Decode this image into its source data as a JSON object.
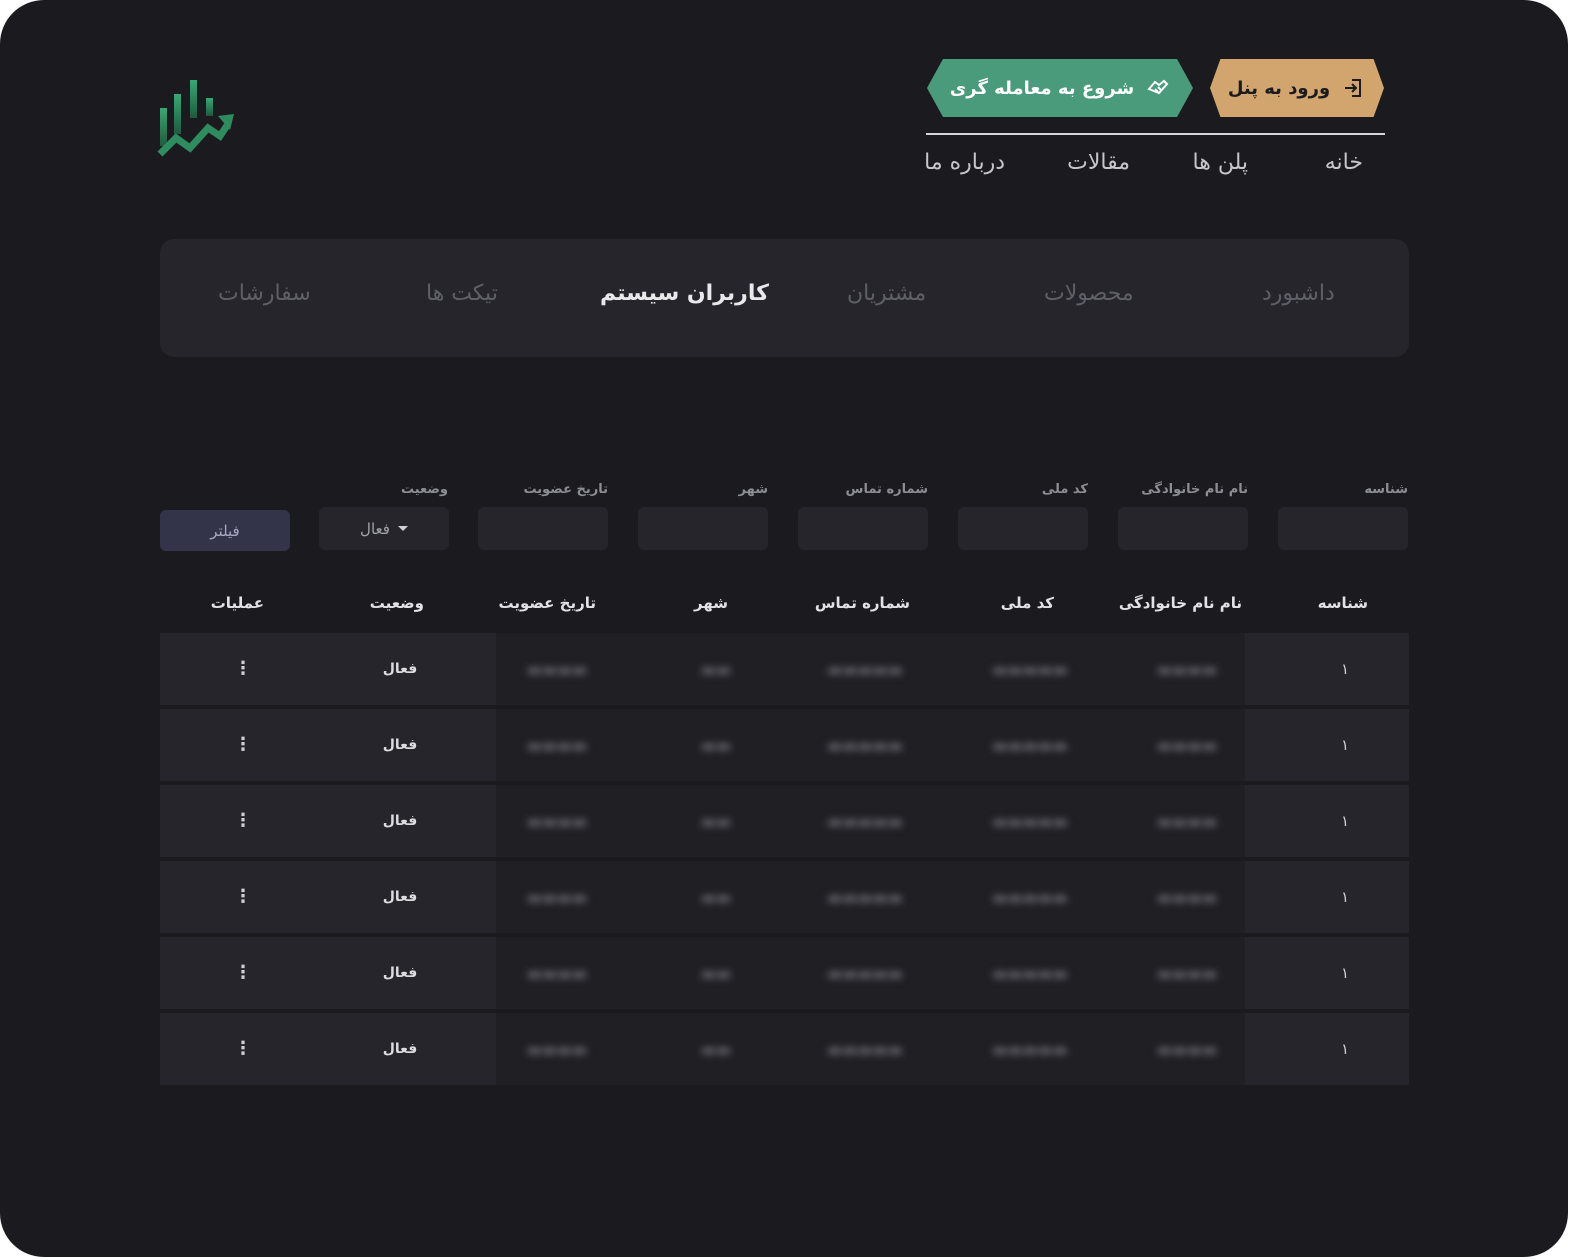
{
  "header": {
    "login_button": "ورود به پنل",
    "trade_button": "شروع به معامله گری",
    "nav": [
      "خانه",
      "پلن ها",
      "مقالات",
      "درباره ما"
    ]
  },
  "tabs": [
    "داشبورد",
    "محصولات",
    "مشتریان",
    "کاربران سیستم",
    "تیکت ها",
    "سفارشات"
  ],
  "active_tab": "کاربران سیستم",
  "filters": {
    "labels": [
      "شناسه",
      "نام نام خانوادگی",
      "کد ملی",
      "شماره تماس",
      "شهر",
      "تاریخ عضویت",
      "وضعیت"
    ],
    "status_value": "فعال",
    "filter_button": "فیلتر"
  },
  "table": {
    "headers": [
      "شناسه",
      "نام نام خانوادگی",
      "کد ملی",
      "شماره تماس",
      "شهر",
      "تاریخ عضویت",
      "وضعیت",
      "عملیات"
    ],
    "rows": [
      {
        "id": "۱",
        "status": "فعال"
      },
      {
        "id": "۱",
        "status": "فعال"
      },
      {
        "id": "۱",
        "status": "فعال"
      },
      {
        "id": "۱",
        "status": "فعال"
      },
      {
        "id": "۱",
        "status": "فعال"
      },
      {
        "id": "۱",
        "status": "فعال"
      }
    ],
    "actions_icon": "kebab-icon"
  },
  "colors": {
    "background": "#1b1b1f",
    "panel": "#25252b",
    "gold": "#d2a56e",
    "green": "#4a9a7c",
    "filter_button": "#33334a"
  }
}
